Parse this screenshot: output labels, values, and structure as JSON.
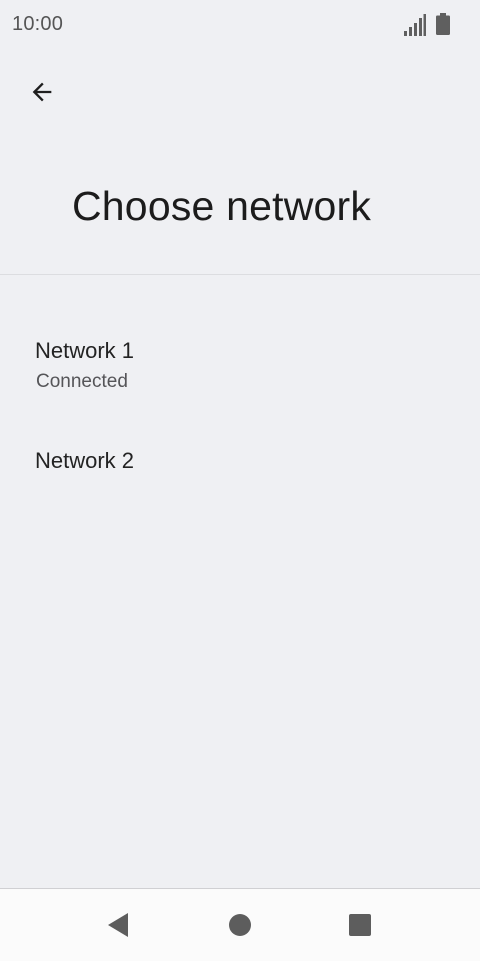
{
  "status_bar": {
    "time": "10:00"
  },
  "header": {
    "title": "Choose network"
  },
  "networks": [
    {
      "name": "Network 1",
      "status": "Connected"
    },
    {
      "name": "Network 2"
    }
  ],
  "icons": {
    "back": "arrow-back-icon",
    "signal": "cell-signal-icon",
    "battery": "battery-icon",
    "nav_back": "nav-back-triangle-icon",
    "nav_home": "nav-home-circle-icon",
    "nav_recents": "nav-recents-square-icon"
  },
  "colors": {
    "background": "#eff0f3",
    "nav_bar": "#fbfbfb",
    "text_primary": "#1c1c1c",
    "text_secondary": "#555558"
  }
}
